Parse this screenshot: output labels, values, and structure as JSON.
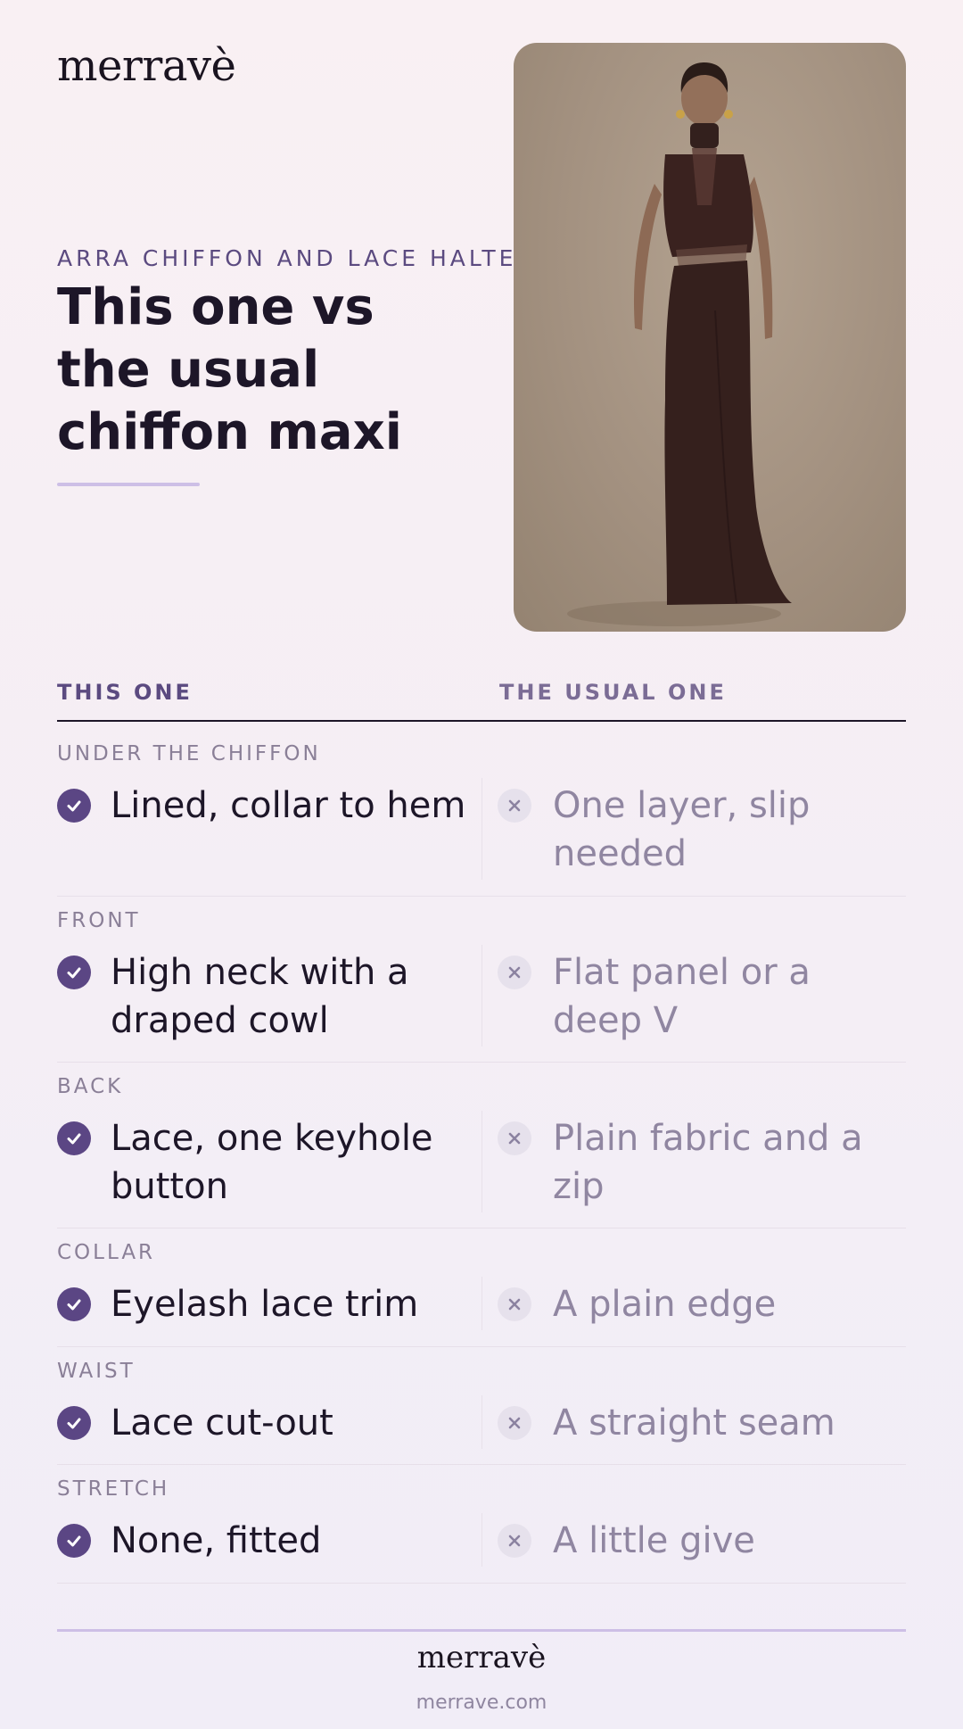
{
  "brand": {
    "logo": "merravè"
  },
  "hero": {
    "eyebrow": "ARRA CHIFFON AND LACE HALTER MAXI DRESS",
    "headline": "This one vs the usual chiffon maxi",
    "image_alt": "Model wearing a chocolate brown chiffon and lace halter maxi dress"
  },
  "table": {
    "col_this": "THIS ONE",
    "col_usual": "THE USUAL ONE",
    "rows": [
      {
        "label": "UNDER THE CHIFFON",
        "this": "Lined, collar to hem",
        "usual": "One layer, slip needed"
      },
      {
        "label": "FRONT",
        "this": "High neck with a draped cowl",
        "usual": "Flat panel or a deep V"
      },
      {
        "label": "BACK",
        "this": "Lace, one keyhole button",
        "usual": "Plain fabric and a zip"
      },
      {
        "label": "COLLAR",
        "this": "Eyelash lace trim",
        "usual": "A plain edge"
      },
      {
        "label": "WAIST",
        "this": "Lace cut-out",
        "usual": "A straight seam"
      },
      {
        "label": "STRETCH",
        "this": "None, fitted",
        "usual": "A little give"
      }
    ]
  },
  "footer": {
    "logo": "merravè",
    "url": "merrave.com"
  },
  "colors": {
    "accent": "#5b4684",
    "muted": "#9086a1",
    "rule": "#cdbfe6"
  }
}
